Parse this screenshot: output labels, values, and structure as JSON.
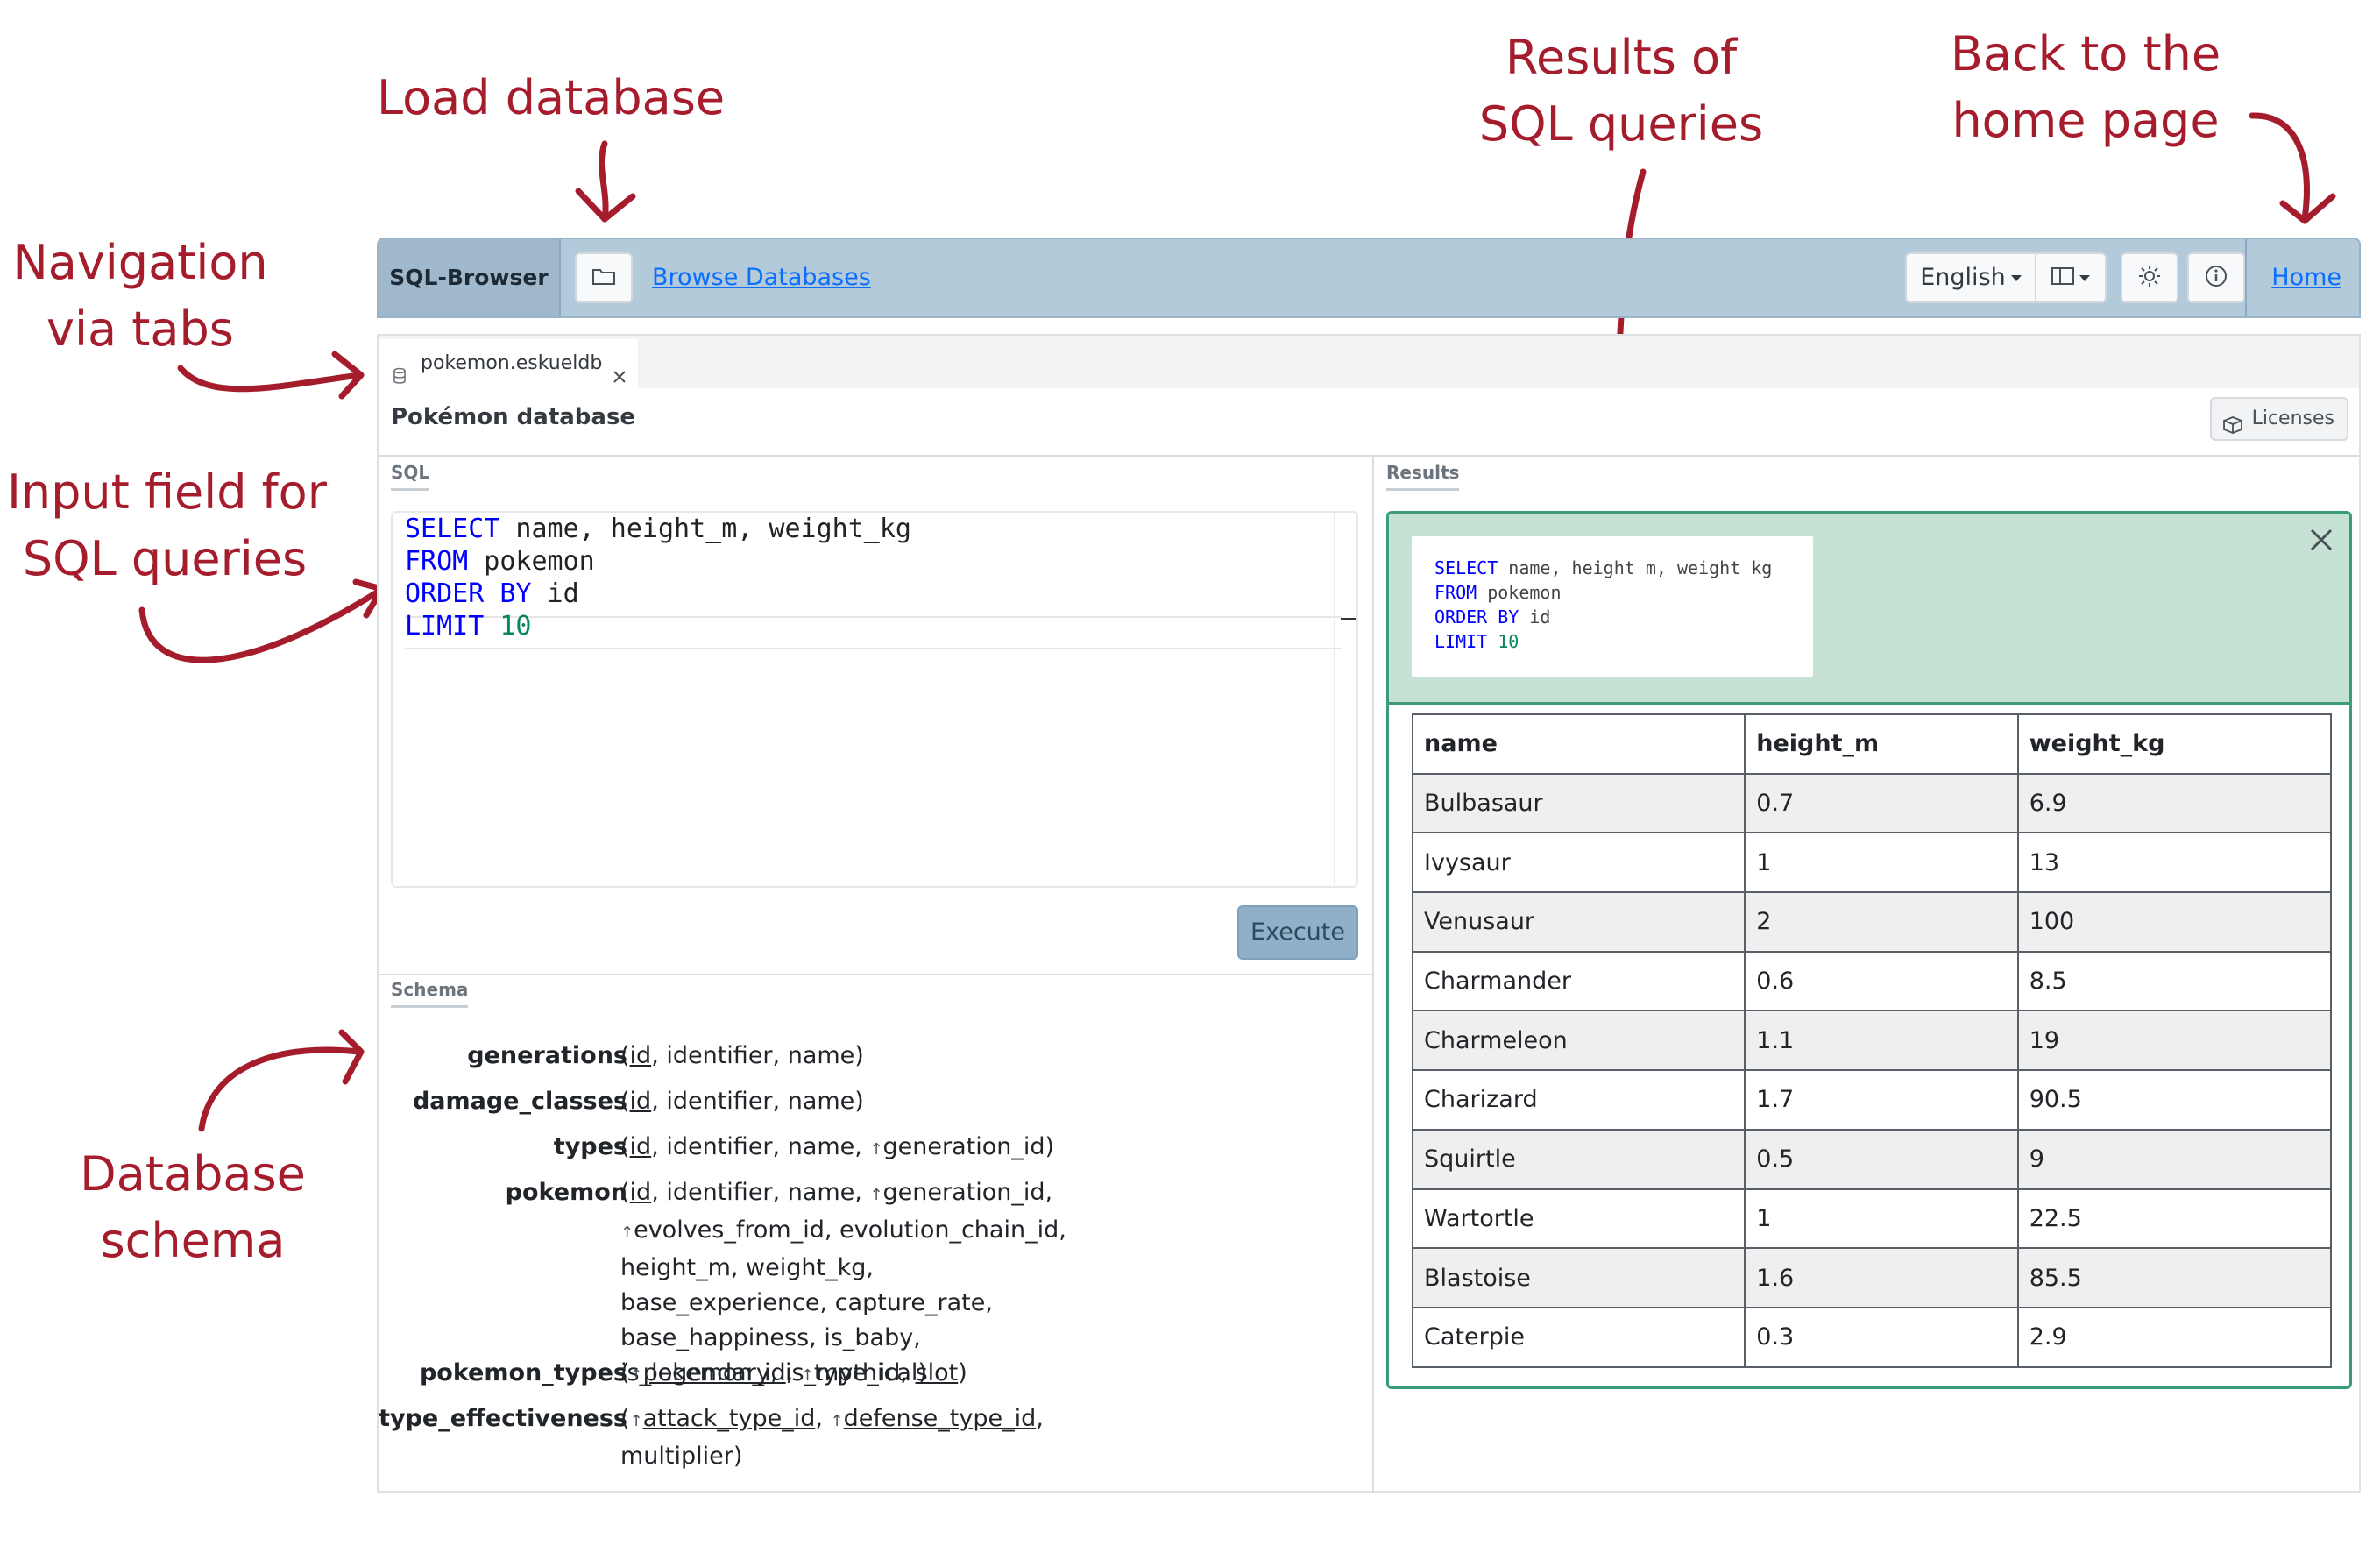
{
  "annotations": {
    "load_database": "Load database",
    "results_line1": "Results of",
    "results_line2": "SQL queries",
    "back_line1": "Back to the",
    "back_line2": "home page",
    "nav_line1": "Navigation",
    "nav_line2": "via tabs",
    "input_line1": "Input field for",
    "input_line2": "SQL queries",
    "schema_line1": "Database",
    "schema_line2": "schema",
    "color": "#a51d2d"
  },
  "navbar": {
    "brand": "SQL-Browser",
    "folder_icon": "folder-icon",
    "browse_label": "Browse Databases",
    "language": "English",
    "layout_icon": "layout-columns-icon",
    "theme_icon": "sun-icon",
    "info_icon": "info-icon",
    "home_label": "Home",
    "bg_color": "#b3cadb"
  },
  "tabs": [
    {
      "label": "pokemon.eskueldb",
      "icon": "database-icon",
      "close_icon": "close-icon"
    }
  ],
  "database": {
    "title": "Pokémon database",
    "licenses_label": "Licenses",
    "licenses_icon": "package-icon"
  },
  "sql": {
    "section_label": "SQL",
    "lines": [
      [
        {
          "t": "SELECT",
          "k": "kw"
        },
        {
          "t": " name, height_m, weight_kg",
          "k": ""
        }
      ],
      [
        {
          "t": "FROM",
          "k": "kw"
        },
        {
          "t": " pokemon",
          "k": ""
        }
      ],
      [
        {
          "t": "ORDER BY",
          "k": "kw"
        },
        {
          "t": " id",
          "k": ""
        }
      ],
      [
        {
          "t": "LIMIT",
          "k": "kw"
        },
        {
          "t": " ",
          "k": ""
        },
        {
          "t": "10",
          "k": "num"
        }
      ]
    ],
    "execute_label": "Execute"
  },
  "schema": {
    "section_label": "Schema",
    "tables": [
      {
        "name": "generations",
        "cols": [
          {
            "n": "id",
            "pk": true
          },
          {
            "n": "identifier"
          },
          {
            "n": "name"
          }
        ]
      },
      {
        "name": "damage_classes",
        "cols": [
          {
            "n": "id",
            "pk": true
          },
          {
            "n": "identifier"
          },
          {
            "n": "name"
          }
        ]
      },
      {
        "name": "types",
        "cols": [
          {
            "n": "id",
            "pk": true
          },
          {
            "n": "identifier"
          },
          {
            "n": "name"
          },
          {
            "n": "generation_id",
            "fk": true
          }
        ]
      },
      {
        "name": "pokemon",
        "cols": [
          {
            "n": "id",
            "pk": true
          },
          {
            "n": "identifier"
          },
          {
            "n": "name"
          },
          {
            "n": "generation_id",
            "fk": true
          },
          {
            "n": "evolves_from_id",
            "fk": true
          },
          {
            "n": "evolution_chain_id"
          },
          {
            "n": "height_m"
          },
          {
            "n": "weight_kg"
          },
          {
            "n": "base_experience"
          },
          {
            "n": "capture_rate"
          },
          {
            "n": "base_happiness"
          },
          {
            "n": "is_baby"
          },
          {
            "n": "is_legendary"
          },
          {
            "n": "is_mythical"
          }
        ]
      },
      {
        "name": "pokemon_types",
        "cols": [
          {
            "n": "pokemon_id",
            "pk": true,
            "fk": true
          },
          {
            "n": "type_id",
            "fk": true
          },
          {
            "n": "slot",
            "pk": true
          }
        ]
      },
      {
        "name": "type_effectiveness",
        "cols": [
          {
            "n": "attack_type_id",
            "pk": true,
            "fk": true
          },
          {
            "n": "defense_type_id",
            "pk": true,
            "fk": true
          },
          {
            "n": "multiplier"
          }
        ]
      }
    ]
  },
  "results": {
    "section_label": "Results",
    "close_icon": "close-icon",
    "query_lines": [
      [
        {
          "t": "SELECT",
          "k": "kw"
        },
        {
          "t": " name, height_m, weight_kg",
          "k": ""
        }
      ],
      [
        {
          "t": "FROM",
          "k": "kw"
        },
        {
          "t": " pokemon",
          "k": ""
        }
      ],
      [
        {
          "t": "ORDER BY",
          "k": "kw"
        },
        {
          "t": " id",
          "k": ""
        }
      ],
      [
        {
          "t": "LIMIT",
          "k": "kw"
        },
        {
          "t": " ",
          "k": ""
        },
        {
          "t": "10",
          "k": "num"
        }
      ]
    ],
    "columns": [
      "name",
      "height_m",
      "weight_kg"
    ],
    "rows": [
      [
        "Bulbasaur",
        "0.7",
        "6.9"
      ],
      [
        "Ivysaur",
        "1",
        "13"
      ],
      [
        "Venusaur",
        "2",
        "100"
      ],
      [
        "Charmander",
        "0.6",
        "8.5"
      ],
      [
        "Charmeleon",
        "1.1",
        "19"
      ],
      [
        "Charizard",
        "1.7",
        "90.5"
      ],
      [
        "Squirtle",
        "0.5",
        "9"
      ],
      [
        "Wartortle",
        "1",
        "22.5"
      ],
      [
        "Blastoise",
        "1.6",
        "85.5"
      ],
      [
        "Caterpie",
        "0.3",
        "2.9"
      ]
    ],
    "accent_color": "#3a9d77"
  }
}
